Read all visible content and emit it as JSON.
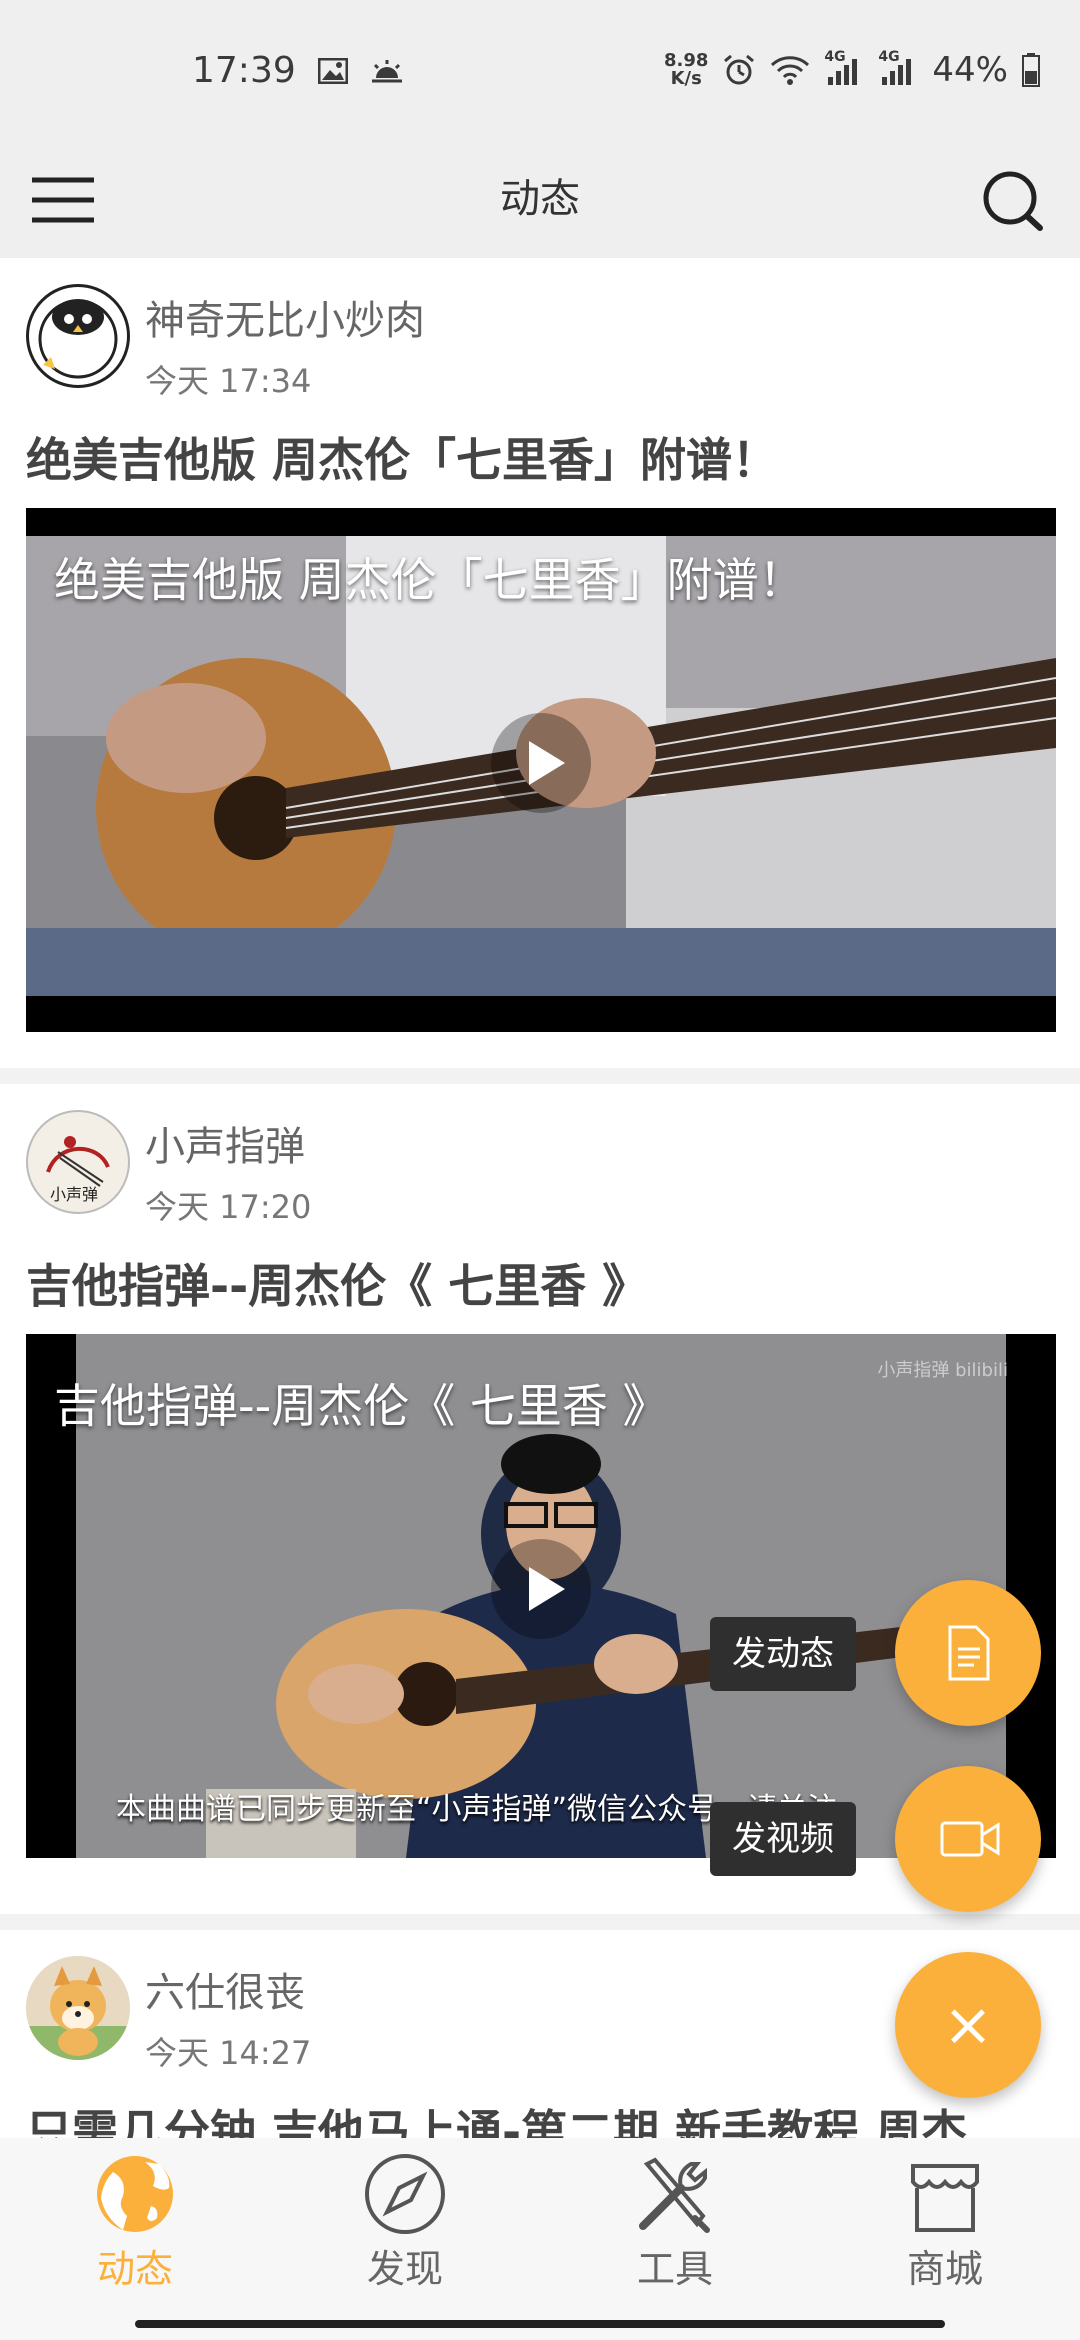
{
  "status_bar": {
    "time": "17:39",
    "net_speed_value": "8.98",
    "net_speed_unit": "K/s",
    "signal_1": "4G",
    "signal_2": "4G",
    "battery": "44%"
  },
  "app_bar": {
    "title": "动态"
  },
  "posts": [
    {
      "author": "神奇无比小炒肉",
      "time": "今天 17:34",
      "title": "绝美吉他版 周杰伦「七里香」附谱！",
      "video_title": "绝美吉他版 周杰伦「七里香」附谱！"
    },
    {
      "author": "小声指弹",
      "time": "今天 17:20",
      "title": "吉他指弹--周杰伦《 七里香 》",
      "video_title": "吉他指弹--周杰伦《 七里香 》",
      "watermark": "小声指弹 bilibili",
      "subtitle": "本曲曲谱已同步更新至“小声指弹”微信公众号，请关注"
    },
    {
      "author": "六仕很丧",
      "time": "今天 14:27",
      "title": "只需几分钟 吉他马上通-第二期 新手教程 周杰"
    }
  ],
  "fab_menu": {
    "post_label": "发动态",
    "video_label": "发视频",
    "close_symbol": "×"
  },
  "bottom_nav": [
    {
      "label": "动态",
      "active": true
    },
    {
      "label": "发现",
      "active": false
    },
    {
      "label": "工具",
      "active": false
    },
    {
      "label": "商城",
      "active": false
    }
  ],
  "colors": {
    "accent": "#fbb03b",
    "label_bg": "#2f2f2f"
  }
}
